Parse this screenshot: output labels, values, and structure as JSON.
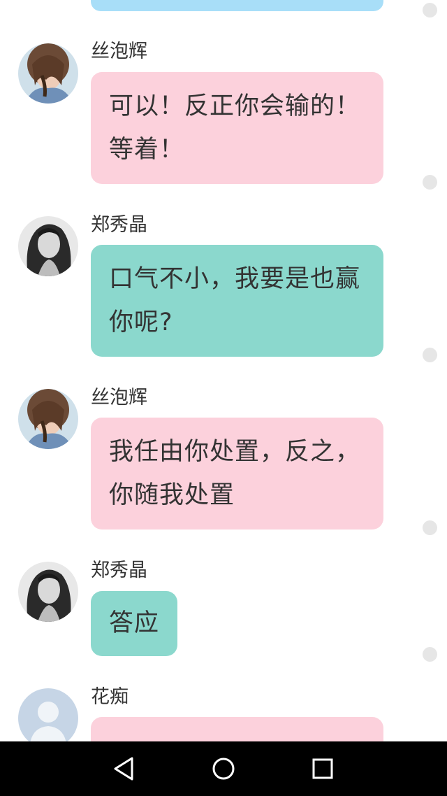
{
  "messages": [
    {
      "sender": "丝泡辉",
      "text": "可以！反正你会输的！等着！",
      "avatar": "avatar-brown-hair"
    },
    {
      "sender": "郑秀晶",
      "text": "口气不小，我要是也赢你呢?",
      "avatar": "avatar-bw-portrait"
    },
    {
      "sender": "丝泡辉",
      "text": "我任由你处置，反之，你随我处置",
      "avatar": "avatar-brown-hair"
    },
    {
      "sender": "郑秀晶",
      "text": "答应",
      "avatar": "avatar-bw-portrait"
    },
    {
      "sender": "花痴",
      "text": "",
      "avatar": "default-person-icon"
    }
  ],
  "colors": {
    "pink_bubble": "#fcd1dc",
    "teal_bubble": "#8bd8cd",
    "blue_bubble": "#a8def8",
    "navbar": "#000000"
  },
  "navbar": {
    "icons": [
      "back-icon",
      "home-icon",
      "recents-icon"
    ]
  }
}
